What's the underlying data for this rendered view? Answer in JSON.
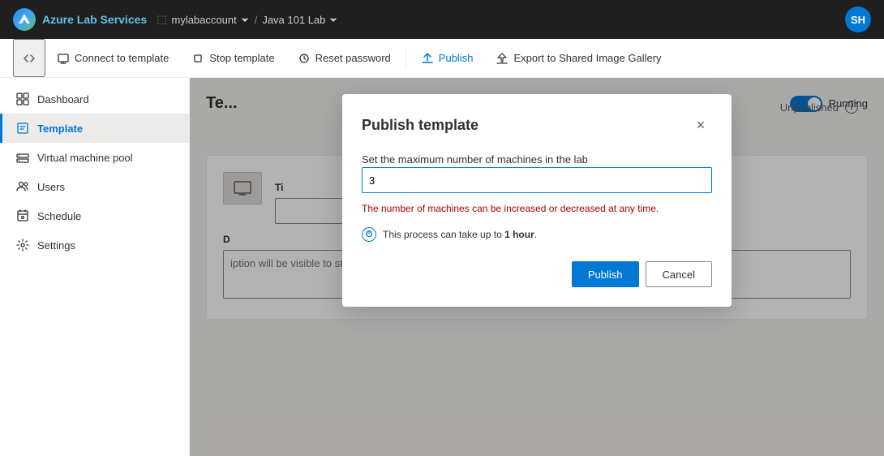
{
  "topbar": {
    "logo_text_bold": "Azure",
    "logo_text": " Lab Services",
    "account": "mylabaccount",
    "lab": "Java 101 Lab",
    "avatar_initials": "SH"
  },
  "toolbar": {
    "collapse_label": "Collapse",
    "connect_label": "Connect to template",
    "stop_label": "Stop template",
    "reset_label": "Reset password",
    "publish_label": "Publish",
    "export_label": "Export to Shared Image Gallery"
  },
  "sidebar": {
    "items": [
      {
        "label": "Dashboard",
        "icon": "dashboard-icon"
      },
      {
        "label": "Template",
        "icon": "template-icon"
      },
      {
        "label": "Virtual machine pool",
        "icon": "vm-pool-icon"
      },
      {
        "label": "Users",
        "icon": "users-icon"
      },
      {
        "label": "Schedule",
        "icon": "schedule-icon"
      },
      {
        "label": "Settings",
        "icon": "settings-icon"
      }
    ]
  },
  "content": {
    "title": "Template",
    "title_truncated": "Te",
    "status": "Unpublished",
    "running_label": "Running",
    "template_name_label": "Ti",
    "description_label": "D",
    "description_placeholder": "iption will be visible to students."
  },
  "modal": {
    "title": "Publish template",
    "close_label": "×",
    "machines_label": "Set the maximum number of machines in the lab",
    "machines_value": "3",
    "warning_text": "The number of machines can be increased or decreased at any time.",
    "info_text_prefix": "This process can take up to ",
    "info_text_bold": "1 hour",
    "info_text_suffix": ".",
    "publish_label": "Publish",
    "cancel_label": "Cancel"
  }
}
